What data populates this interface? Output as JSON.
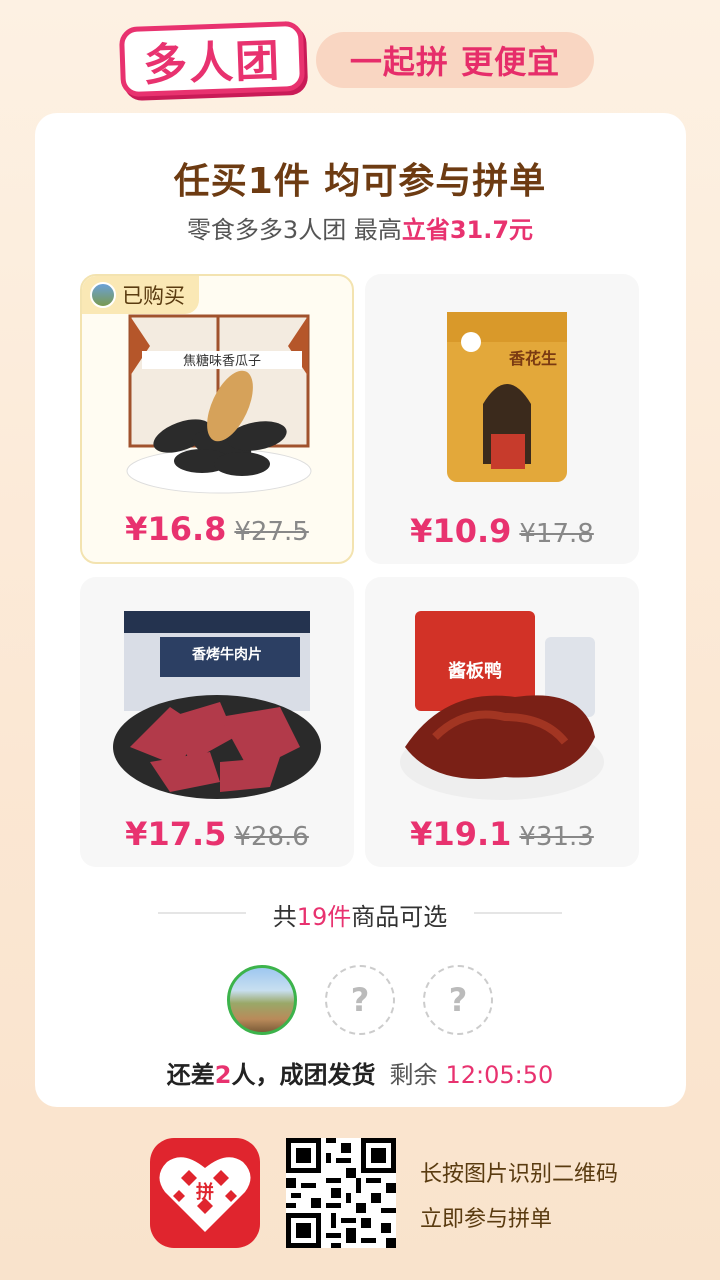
{
  "header": {
    "logo_text": "多人团",
    "slogan": "一起拼 更便宜"
  },
  "card": {
    "title": "任买1件 均可参与拼单",
    "subtitle_prefix": "零食多多3人团 最高",
    "subtitle_highlight": "立省31.7元"
  },
  "products": [
    {
      "price": "¥16.8",
      "original_price": "¥27.5",
      "badge": "已购买",
      "package_text": "焦糖味香瓜子"
    },
    {
      "price": "¥10.9",
      "original_price": "¥17.8",
      "package_text": "香花生"
    },
    {
      "price": "¥17.5",
      "original_price": "¥28.6",
      "package_text": "香烤牛肉片"
    },
    {
      "price": "¥19.1",
      "original_price": "¥31.3",
      "package_text": "酱板鸭"
    }
  ],
  "more": {
    "prefix": "共",
    "count": "19件",
    "suffix": "商品可选"
  },
  "group": {
    "empty_slot_symbol": "?",
    "status_prefix": "还差",
    "status_count": "2",
    "status_suffix": "人，成团发货",
    "remaining_label": "剩余",
    "countdown": "12:05:50"
  },
  "footer": {
    "app_icon_text": "拼",
    "line1": "长按图片识别二维码",
    "line2": "立即参与拼单"
  },
  "colors": {
    "accent": "#e8326f",
    "brand_brown": "#6d3b12",
    "app_red": "#e0252e"
  }
}
